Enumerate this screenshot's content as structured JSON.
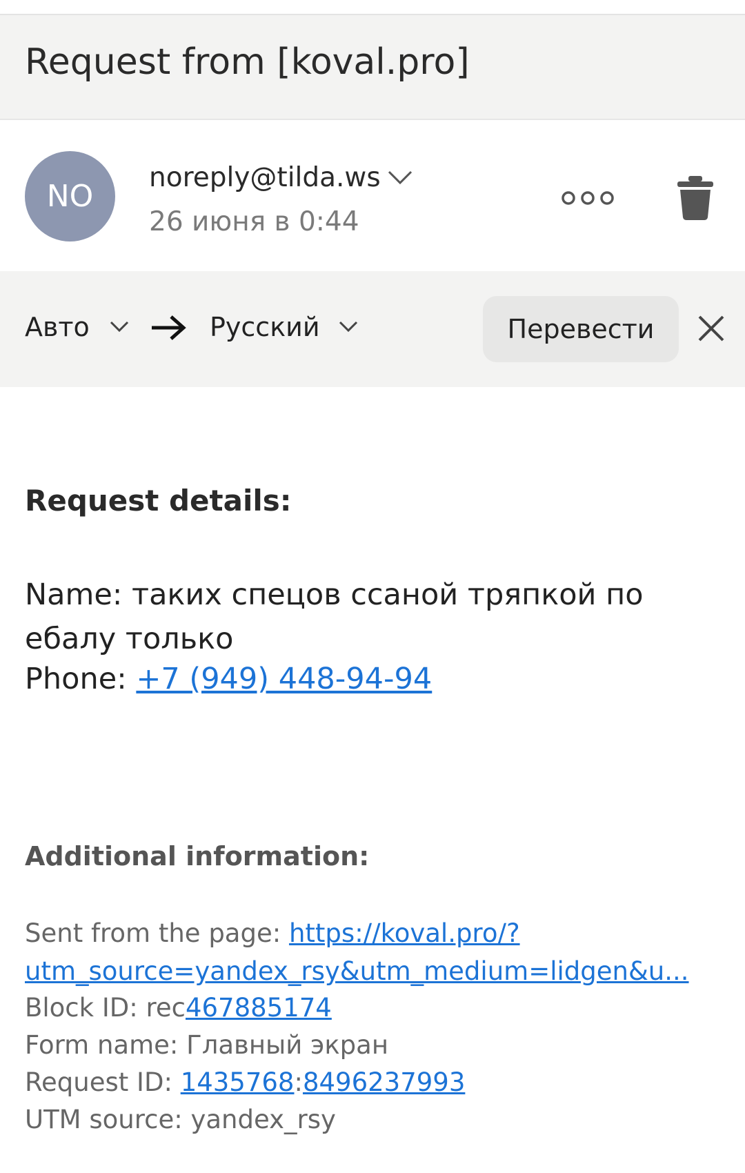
{
  "header": {
    "subject": "Request from [koval.pro]"
  },
  "sender": {
    "avatar_initials": "NO",
    "email": "noreply@tilda.ws",
    "date": "26 июня в 0:44",
    "icons": [
      "chevron-down-icon",
      "more-icon",
      "trash-icon"
    ]
  },
  "translate": {
    "source_lang": "Авто",
    "target_lang": "Русский",
    "translate_label": "Перевести",
    "icons": [
      "chevron-down-icon",
      "arrow-right-icon",
      "close-icon"
    ]
  },
  "message": {
    "request_title": "Request details:",
    "name_label": "Name: ",
    "name_value": "таких спецов ссаной тряпкой по ебалу только",
    "phone_label": "Phone: ",
    "phone_value": "+7 (949) 448-94-94",
    "additional_title": "Additional information:",
    "sent_from_label": "Sent from the page: ",
    "sent_from_url_line1": "https://koval.pro/?",
    "sent_from_url_line2": "utm_source=yandex_rsy&utm_medium=lidgen&u...",
    "block_id_label": "Block ID: rec",
    "block_id_value": "467885174",
    "form_name_label": "Form name: Главный экран",
    "request_id_label": "Request ID: ",
    "request_id_part1": "1435768",
    "request_id_sep": ":",
    "request_id_part2": "8496237993",
    "utm_source_label": "UTM source: yandex_rsy"
  },
  "colors": {
    "link": "#1c73d6",
    "avatar": "#8d97b0",
    "bar_bg": "#f3f3f2"
  }
}
